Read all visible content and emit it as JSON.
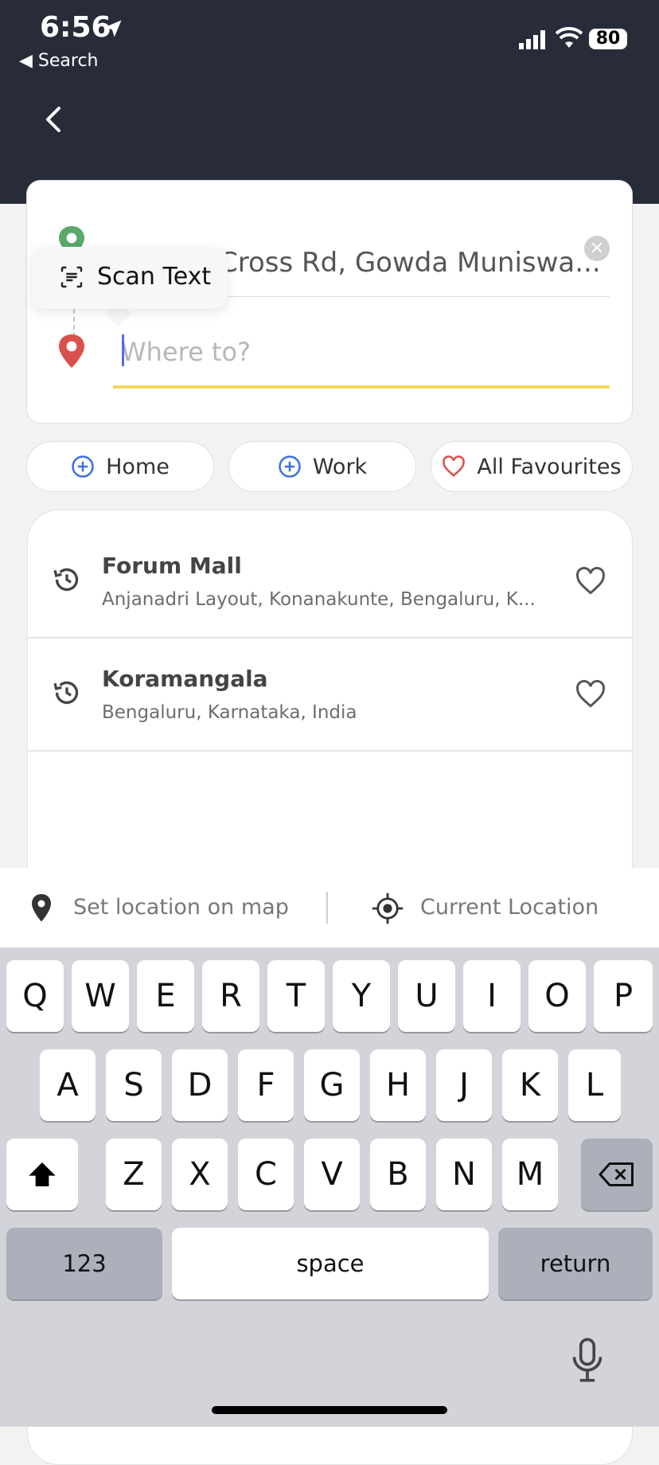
{
  "status_bar": {
    "time": "6:56",
    "back_app": "Search",
    "battery": "80"
  },
  "search": {
    "from_value": "Cross Rd, Gowda Muniswa...",
    "to_placeholder": "Where to?"
  },
  "popover": {
    "scan_text_label": "Scan Text"
  },
  "chips": [
    {
      "label": "Home",
      "icon": "plus-circle-icon"
    },
    {
      "label": "Work",
      "icon": "plus-circle-icon"
    },
    {
      "label": "All Favourites",
      "icon": "heart-icon"
    }
  ],
  "recents": [
    {
      "title": "Forum Mall",
      "subtitle": "Anjanadri Layout, Konanakunte, Bengaluru, K..."
    },
    {
      "title": "Koramangala",
      "subtitle": "Bengaluru, Karnataka, India"
    }
  ],
  "actions": {
    "set_on_map": "Set location on map",
    "current_location": "Current Location"
  },
  "keyboard": {
    "row1": [
      "Q",
      "W",
      "E",
      "R",
      "T",
      "Y",
      "U",
      "I",
      "O",
      "P"
    ],
    "row2": [
      "A",
      "S",
      "D",
      "F",
      "G",
      "H",
      "J",
      "K",
      "L"
    ],
    "row3": [
      "Z",
      "X",
      "C",
      "V",
      "B",
      "N",
      "M"
    ],
    "numbers": "123",
    "space": "space",
    "return": "return"
  },
  "colors": {
    "header_bg": "#282c39",
    "accent_yellow": "#f3d95a",
    "origin_pin": "#5aa86a",
    "destination_pin": "#d9504c",
    "chip_plus": "#3d6ee8",
    "heart_red": "#d9504c"
  }
}
